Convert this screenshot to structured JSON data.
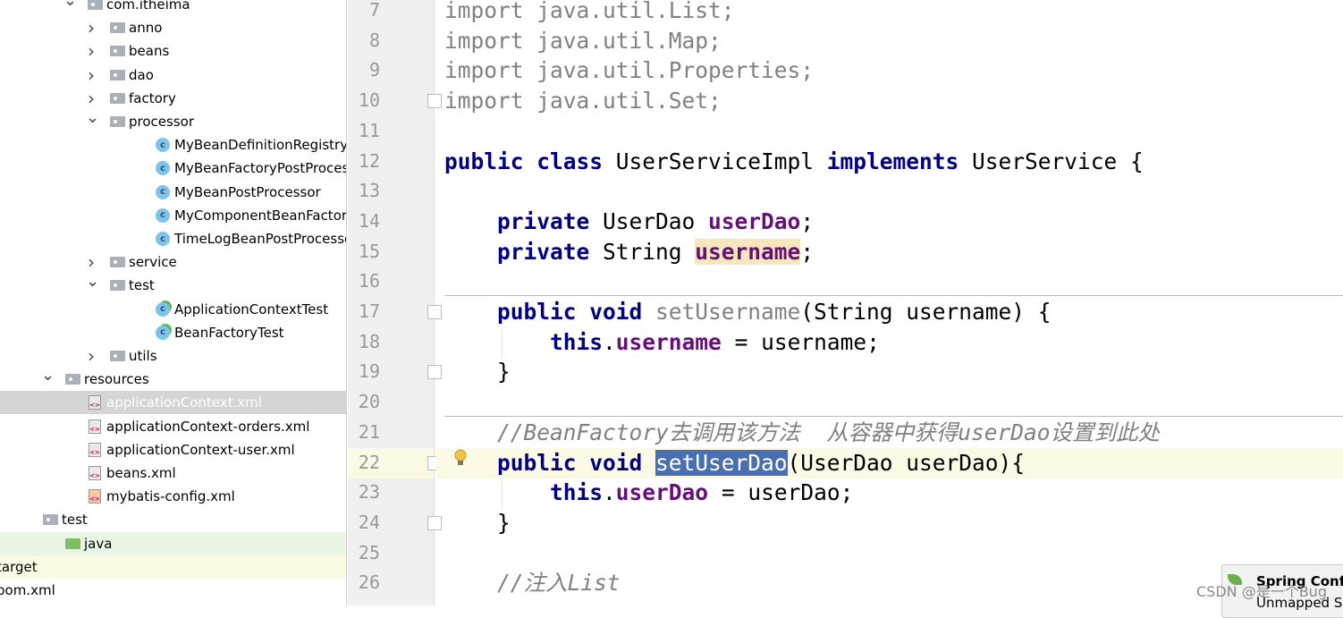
{
  "project_tree": [
    {
      "label": "com.itheima",
      "type": "package",
      "depth": 1,
      "state": "open"
    },
    {
      "label": "anno",
      "type": "folder",
      "depth": 2,
      "state": "closed"
    },
    {
      "label": "beans",
      "type": "folder",
      "depth": 2,
      "state": "closed"
    },
    {
      "label": "dao",
      "type": "folder",
      "depth": 2,
      "state": "closed"
    },
    {
      "label": "factory",
      "type": "folder",
      "depth": 2,
      "state": "closed"
    },
    {
      "label": "processor",
      "type": "folder",
      "depth": 2,
      "state": "open"
    },
    {
      "label": "MyBeanDefinitionRegistryPostProcessor",
      "type": "class",
      "depth": 3
    },
    {
      "label": "MyBeanFactoryPostProcessor",
      "type": "class",
      "depth": 3
    },
    {
      "label": "MyBeanPostProcessor",
      "type": "class",
      "depth": 3
    },
    {
      "label": "MyComponentBeanFactoryPostProcessor",
      "type": "class",
      "depth": 3
    },
    {
      "label": "TimeLogBeanPostProcessor",
      "type": "class",
      "depth": 3
    },
    {
      "label": "service",
      "type": "folder",
      "depth": 2,
      "state": "closed"
    },
    {
      "label": "test",
      "type": "folder",
      "depth": 2,
      "state": "open"
    },
    {
      "label": "ApplicationContextTest",
      "type": "testclass",
      "depth": 3
    },
    {
      "label": "BeanFactoryTest",
      "type": "testclass",
      "depth": 3
    },
    {
      "label": "utils",
      "type": "folder",
      "depth": 2,
      "state": "closed"
    },
    {
      "label": "resources",
      "type": "resources",
      "depth": 0,
      "state": "open"
    },
    {
      "label": "applicationContext.xml",
      "type": "xml",
      "depth": 1,
      "selected": true
    },
    {
      "label": "applicationContext-orders.xml",
      "type": "xml",
      "depth": 1
    },
    {
      "label": "applicationContext-user.xml",
      "type": "xml",
      "depth": 1
    },
    {
      "label": "beans.xml",
      "type": "xml",
      "depth": 1
    },
    {
      "label": "mybatis-config.xml",
      "type": "xmlo",
      "depth": 1
    },
    {
      "label": "test",
      "type": "folder",
      "depth": -1
    },
    {
      "label": "java",
      "type": "greenfolder",
      "depth": 0,
      "highlight": "green"
    },
    {
      "label": "target",
      "type": "none",
      "depth": -2,
      "highlight": "yellow"
    },
    {
      "label": "pom.xml",
      "type": "none",
      "depth": -2
    }
  ],
  "editor": {
    "first_line": 7,
    "lines": [
      [
        [
          "kw0",
          "import "
        ],
        [
          "gr",
          "java.util.List;"
        ]
      ],
      [
        [
          "kw0",
          "import "
        ],
        [
          "gr",
          "java.util.Map;"
        ]
      ],
      [
        [
          "kw0",
          "import "
        ],
        [
          "gr",
          "java.util.Properties;"
        ]
      ],
      [
        [
          "kw0",
          "import "
        ],
        [
          "gr",
          "java.util.Set;"
        ]
      ],
      [],
      [
        [
          "kw",
          "public class "
        ],
        [
          "",
          "UserServiceImpl "
        ],
        [
          "kw",
          "implements "
        ],
        [
          "",
          "UserService {"
        ]
      ],
      [],
      [
        [
          "",
          "    "
        ],
        [
          "kw",
          "private "
        ],
        [
          "",
          "UserDao "
        ],
        [
          "fld",
          "userDao"
        ],
        [
          "",
          ";"
        ]
      ],
      [
        [
          "",
          "    "
        ],
        [
          "kw",
          "private "
        ],
        [
          "",
          "String "
        ],
        [
          "fld uhl",
          "username"
        ],
        [
          "",
          ";"
        ]
      ],
      [],
      [
        [
          "",
          "    "
        ],
        [
          "kw",
          "public void "
        ],
        [
          "meth",
          "setUsername"
        ],
        [
          "",
          "(String username) {"
        ]
      ],
      [
        [
          "",
          "        "
        ],
        [
          "kw",
          "this"
        ],
        [
          "",
          "."
        ],
        [
          "fld",
          "username"
        ],
        [
          "",
          " = username;"
        ]
      ],
      [
        [
          "",
          "    }"
        ]
      ],
      [],
      [
        [
          "",
          "    "
        ],
        [
          "cm",
          "//BeanFactory去调用该方法  从容器中获得userDao设置到此处"
        ]
      ],
      [
        [
          "",
          "    "
        ],
        [
          "kw",
          "public void "
        ],
        [
          "sel",
          "setUserDao"
        ],
        [
          "",
          "(UserDao userDao){"
        ]
      ],
      [
        [
          "",
          "        "
        ],
        [
          "kw",
          "this"
        ],
        [
          "",
          "."
        ],
        [
          "fld",
          "userDao"
        ],
        [
          "",
          " = userDao;"
        ]
      ],
      [
        [
          "",
          "    }"
        ]
      ],
      [],
      [
        [
          "",
          "    "
        ],
        [
          "cm",
          "//注入List"
        ]
      ]
    ],
    "current_line": 22
  },
  "notification": {
    "title": "Spring Config",
    "body": "Unmapped S"
  },
  "watermark": "CSDN @是一个Bug"
}
